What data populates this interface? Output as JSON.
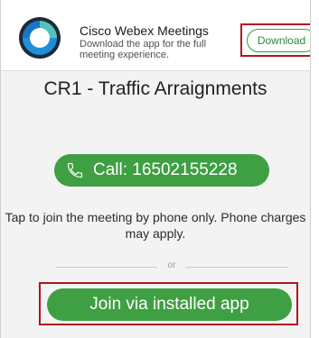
{
  "app_banner": {
    "title": "Cisco Webex Meetings",
    "subtitle": "Download the app for the full meeting experience.",
    "download_label": "Download",
    "logo_icon": "webex-logo-icon"
  },
  "meeting": {
    "title": "CR1 - Traffic Arraignments"
  },
  "call": {
    "label": "Call: 16502155228",
    "icon": "phone-icon"
  },
  "phone_note": "Tap to join the meeting by phone only. Phone charges may apply.",
  "separator_text": "or",
  "join_app_label": "Join via installed app",
  "colors": {
    "accent_green": "#3f9f43",
    "highlight_red": "#b3141f",
    "background": "#f3f3f3"
  }
}
